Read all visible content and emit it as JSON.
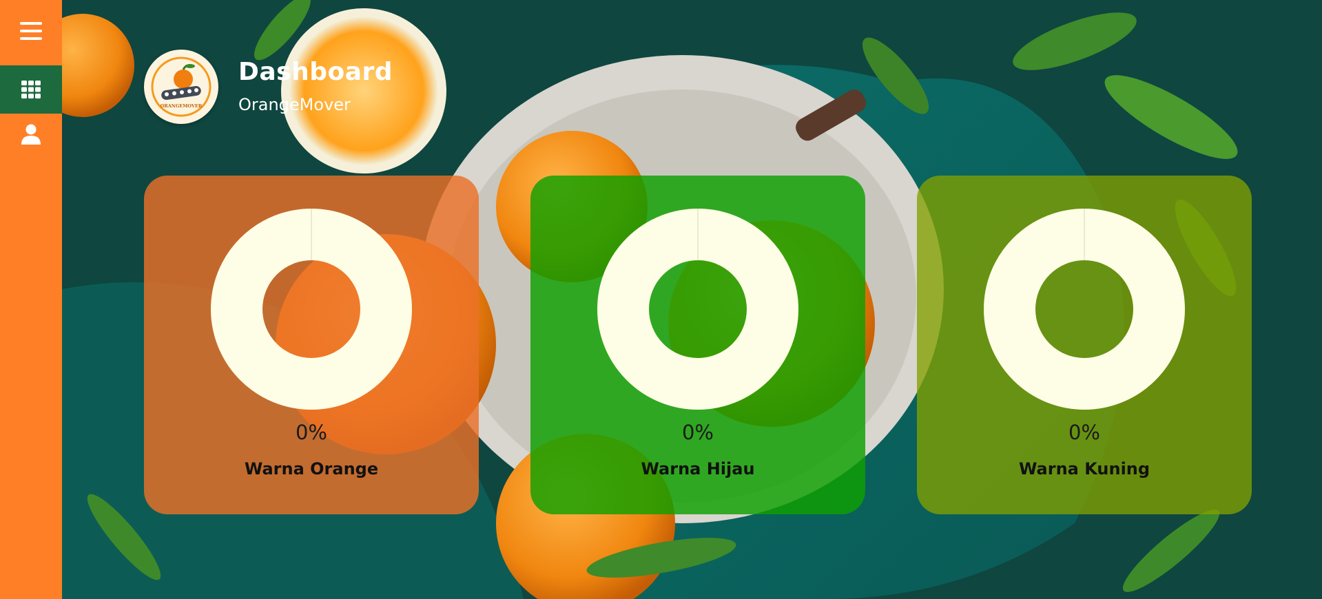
{
  "sidebar": {
    "items": [
      {
        "icon": "hamburger-menu-icon"
      },
      {
        "icon": "grid-apps-icon",
        "active": true
      },
      {
        "icon": "user-icon"
      }
    ],
    "background": "#ff7f27",
    "active_background": "#1c6a3d"
  },
  "header": {
    "title": "Dashboard",
    "subtitle": "OrangeMover",
    "logo": {
      "icon": "orangemover-logo",
      "text": "ORANGEMOVER"
    }
  },
  "cards": [
    {
      "percent": "0%",
      "label": "Warna Orange",
      "color": "#eb7028"
    },
    {
      "percent": "0%",
      "label": "Warna Hijau",
      "color": "#0fa000"
    },
    {
      "percent": "0%",
      "label": "Warna Kuning",
      "color": "#82a000"
    }
  ],
  "chart_data": [
    {
      "type": "pie",
      "labels": [
        "Warna Orange"
      ],
      "values": [
        0
      ],
      "ring_color": "#fefee6",
      "display_value": "0%"
    },
    {
      "type": "pie",
      "labels": [
        "Warna Hijau"
      ],
      "values": [
        0
      ],
      "ring_color": "#fefee6",
      "display_value": "0%"
    },
    {
      "type": "pie",
      "labels": [
        "Warna Kuning"
      ],
      "values": [
        0
      ],
      "ring_color": "#fefee6",
      "display_value": "0%"
    }
  ]
}
